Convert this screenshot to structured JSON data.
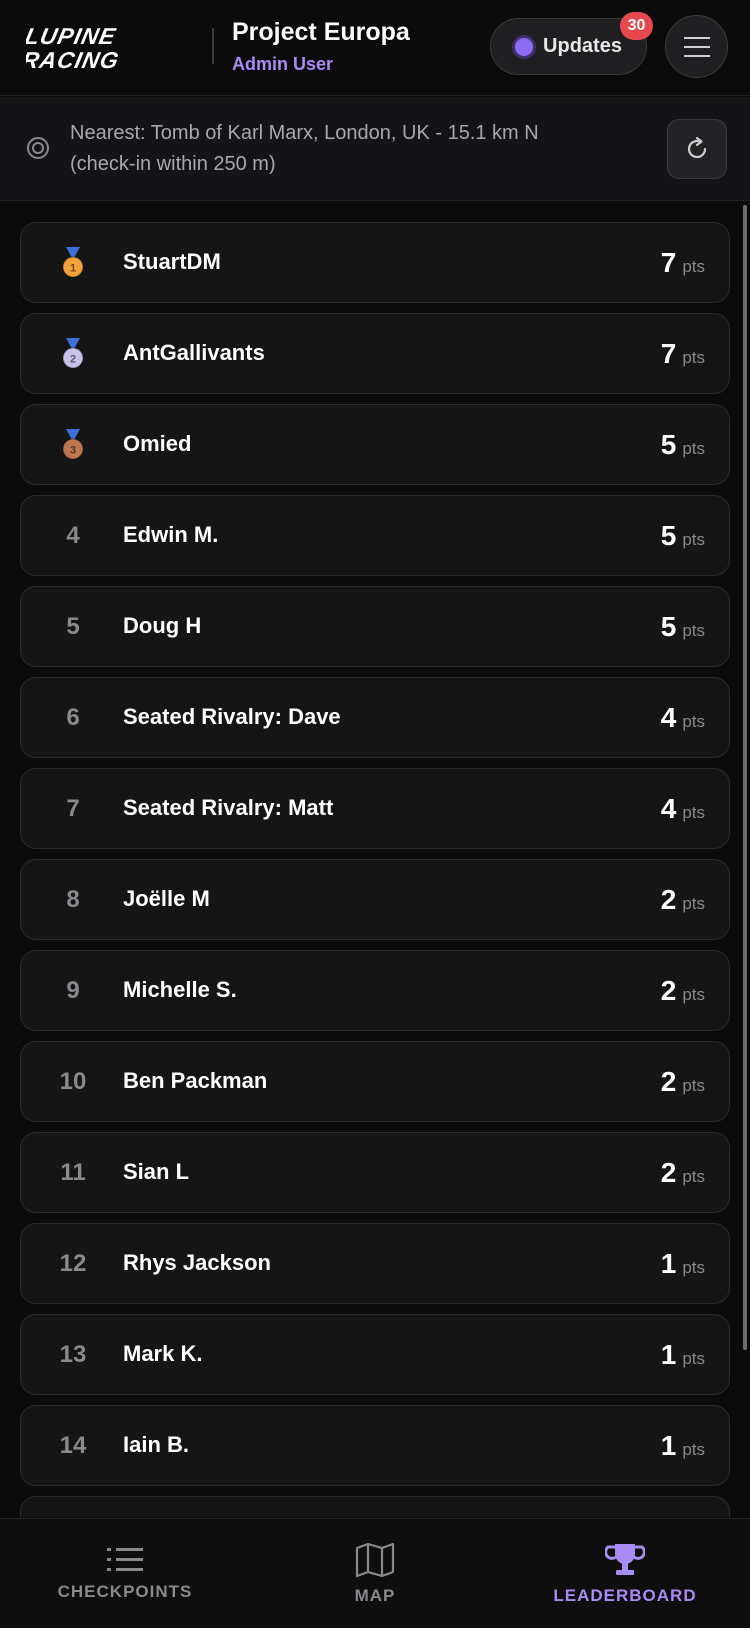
{
  "header": {
    "logo_text": "LUPINE RACING",
    "project_title": "Project Europa",
    "user": "Admin User",
    "updates_label": "Updates",
    "updates_badge": "30"
  },
  "nearest": {
    "line1": "Nearest: Tomb of Karl Marx, London, UK - 15.1 km N",
    "line2": "(check-in within 250 m)"
  },
  "leaderboard": {
    "pts_label": "pts",
    "rows": [
      {
        "rank": "1",
        "medal": "gold",
        "name": "StuartDM",
        "points": "7"
      },
      {
        "rank": "2",
        "medal": "silver",
        "name": "AntGallivants",
        "points": "7"
      },
      {
        "rank": "3",
        "medal": "bronze",
        "name": "Omied",
        "points": "5"
      },
      {
        "rank": "4",
        "name": "Edwin M.",
        "points": "5"
      },
      {
        "rank": "5",
        "name": "Doug H",
        "points": "5"
      },
      {
        "rank": "6",
        "name": "Seated Rivalry: Dave",
        "points": "4"
      },
      {
        "rank": "7",
        "name": "Seated Rivalry: Matt",
        "points": "4"
      },
      {
        "rank": "8",
        "name": "Joëlle M",
        "points": "2"
      },
      {
        "rank": "9",
        "name": "Michelle S.",
        "points": "2"
      },
      {
        "rank": "10",
        "name": "Ben Packman",
        "points": "2"
      },
      {
        "rank": "11",
        "name": "Sian L",
        "points": "2"
      },
      {
        "rank": "12",
        "name": "Rhys Jackson",
        "points": "1"
      },
      {
        "rank": "13",
        "name": "Mark K.",
        "points": "1"
      },
      {
        "rank": "14",
        "name": "Iain B.",
        "points": "1"
      }
    ]
  },
  "nav": {
    "checkpoints": "CHECKPOINTS",
    "map": "MAP",
    "leaderboard": "LEADERBOARD"
  },
  "colors": {
    "accent": "#a98bf5",
    "badge": "#e5484d",
    "gold": "#f2a33a",
    "silver": "#c9c3e8",
    "bronze": "#c0774f",
    "ribbon": "#3f6fd8"
  }
}
